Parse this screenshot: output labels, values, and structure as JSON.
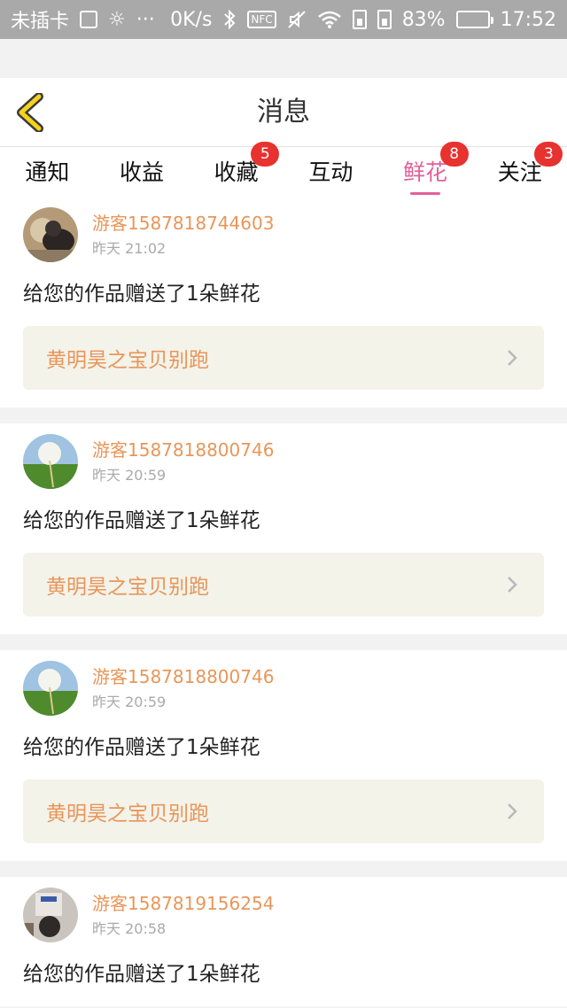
{
  "status_bar": {
    "carrier": "未插卡",
    "speed": "0K/s",
    "nfc": "NFC",
    "battery": "83%",
    "battery_level": 0.83,
    "time": "17:52"
  },
  "header": {
    "title": "消息"
  },
  "tabs": [
    {
      "label": "通知",
      "badge": ""
    },
    {
      "label": "收益",
      "badge": ""
    },
    {
      "label": "收藏",
      "badge": "5"
    },
    {
      "label": "互动",
      "badge": ""
    },
    {
      "label": "鲜花",
      "badge": "8",
      "active": true
    },
    {
      "label": "关注",
      "badge": "3"
    }
  ],
  "messages": [
    {
      "user": "游客1587818744603",
      "time": "昨天 21:02",
      "text": "给您的作品赠送了1朵鲜花",
      "work": "黄明昊之宝贝别跑",
      "avatar": "cat-avatar"
    },
    {
      "user": "游客1587818800746",
      "time": "昨天 20:59",
      "text": "给您的作品赠送了1朵鲜花",
      "work": "黄明昊之宝贝别跑",
      "avatar": "dandelion-avatar"
    },
    {
      "user": "游客1587818800746",
      "time": "昨天 20:59",
      "text": "给您的作品赠送了1朵鲜花",
      "work": "黄明昊之宝贝别跑",
      "avatar": "dandelion-avatar"
    },
    {
      "user": "游客1587819156254",
      "time": "昨天 20:58",
      "text": "给您的作品赠送了1朵鲜花",
      "work": "",
      "avatar": "photo-avatar"
    }
  ],
  "colors": {
    "accent_pink": "#e35f9a",
    "username_orange": "#e8965a",
    "badge_red": "#e8322f",
    "back_arrow_yellow": "#f5d21c"
  }
}
